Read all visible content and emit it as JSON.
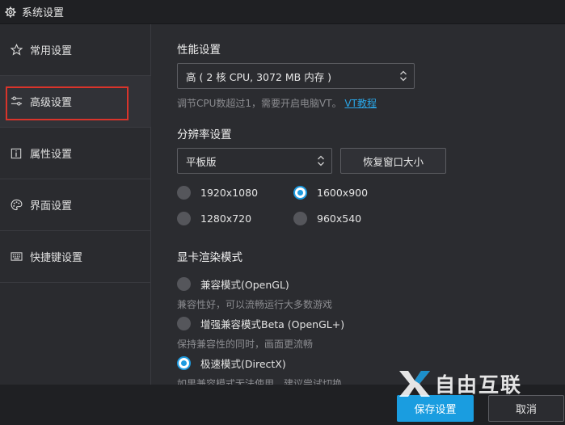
{
  "window": {
    "title": "系统设置",
    "icon": "gear-icon"
  },
  "sidebar": {
    "items": [
      {
        "label": "常用设置",
        "icon": "star-icon"
      },
      {
        "label": "高级设置",
        "icon": "sliders-icon",
        "active": true
      },
      {
        "label": "属性设置",
        "icon": "info-icon"
      },
      {
        "label": "界面设置",
        "icon": "palette-icon"
      },
      {
        "label": "快捷键设置",
        "icon": "keyboard-icon"
      }
    ]
  },
  "performance": {
    "title": "性能设置",
    "selected": "高 ( 2 核 CPU, 3072 MB 内存 )",
    "hint": "调节CPU数超过1，需要开启电脑VT。",
    "link": "VT教程"
  },
  "resolution": {
    "title": "分辨率设置",
    "selected": "平板版",
    "restore_button": "恢复窗口大小",
    "options": [
      {
        "label": "1920x1080",
        "checked": false
      },
      {
        "label": "1600x900",
        "checked": true
      },
      {
        "label": "1280x720",
        "checked": false
      },
      {
        "label": "960x540",
        "checked": false
      }
    ]
  },
  "render": {
    "title": "显卡渲染模式",
    "options": [
      {
        "label": "兼容模式(OpenGL)",
        "desc": "兼容性好，可以流畅运行大多数游戏",
        "checked": false
      },
      {
        "label": "增强兼容模式Beta (OpenGL+)",
        "desc": "保持兼容性的同时，画面更流畅",
        "checked": false
      },
      {
        "label": "极速模式(DirectX)",
        "desc": "如果兼容模式无法使用，建议尝试切换",
        "checked": true
      }
    ]
  },
  "footer": {
    "save": "保存设置",
    "cancel": "取消"
  },
  "watermark": {
    "text": "自由互联"
  },
  "colors": {
    "accent": "#1a9de0",
    "highlight_box": "#d9342b",
    "link": "#2aa7e8"
  }
}
